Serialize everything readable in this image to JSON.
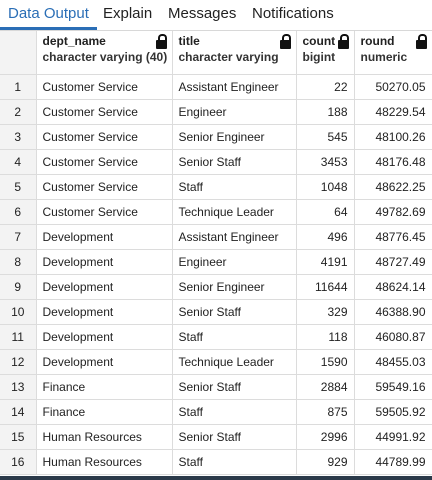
{
  "tabs": [
    {
      "label": "Data Output",
      "active": true
    },
    {
      "label": "Explain",
      "active": false
    },
    {
      "label": "Messages",
      "active": false
    },
    {
      "label": "Notifications",
      "active": false
    }
  ],
  "columns": [
    {
      "name": "dept_name",
      "type": "character varying (40)"
    },
    {
      "name": "title",
      "type": "character varying"
    },
    {
      "name": "count",
      "type": "bigint"
    },
    {
      "name": "round",
      "type": "numeric"
    }
  ],
  "rows": [
    {
      "n": "1",
      "dept_name": "Customer Service",
      "title": "Assistant Engineer",
      "count": "22",
      "round": "50270.05"
    },
    {
      "n": "2",
      "dept_name": "Customer Service",
      "title": "Engineer",
      "count": "188",
      "round": "48229.54"
    },
    {
      "n": "3",
      "dept_name": "Customer Service",
      "title": "Senior Engineer",
      "count": "545",
      "round": "48100.26"
    },
    {
      "n": "4",
      "dept_name": "Customer Service",
      "title": "Senior Staff",
      "count": "3453",
      "round": "48176.48"
    },
    {
      "n": "5",
      "dept_name": "Customer Service",
      "title": "Staff",
      "count": "1048",
      "round": "48622.25"
    },
    {
      "n": "6",
      "dept_name": "Customer Service",
      "title": "Technique Leader",
      "count": "64",
      "round": "49782.69"
    },
    {
      "n": "7",
      "dept_name": "Development",
      "title": "Assistant Engineer",
      "count": "496",
      "round": "48776.45"
    },
    {
      "n": "8",
      "dept_name": "Development",
      "title": "Engineer",
      "count": "4191",
      "round": "48727.49"
    },
    {
      "n": "9",
      "dept_name": "Development",
      "title": "Senior Engineer",
      "count": "11644",
      "round": "48624.14"
    },
    {
      "n": "10",
      "dept_name": "Development",
      "title": "Senior Staff",
      "count": "329",
      "round": "46388.90"
    },
    {
      "n": "11",
      "dept_name": "Development",
      "title": "Staff",
      "count": "118",
      "round": "46080.87"
    },
    {
      "n": "12",
      "dept_name": "Development",
      "title": "Technique Leader",
      "count": "1590",
      "round": "48455.03"
    },
    {
      "n": "13",
      "dept_name": "Finance",
      "title": "Senior Staff",
      "count": "2884",
      "round": "59549.16"
    },
    {
      "n": "14",
      "dept_name": "Finance",
      "title": "Staff",
      "count": "875",
      "round": "59505.92"
    },
    {
      "n": "15",
      "dept_name": "Human Resources",
      "title": "Senior Staff",
      "count": "2996",
      "round": "44991.92"
    },
    {
      "n": "16",
      "dept_name": "Human Resources",
      "title": "Staff",
      "count": "929",
      "round": "44789.99"
    }
  ],
  "colors": {
    "accent": "#2a6eb6",
    "rownum_bg": "#f3f3f3",
    "border": "#dcdcdc"
  },
  "icons": {
    "column_lock": "lock-icon"
  }
}
